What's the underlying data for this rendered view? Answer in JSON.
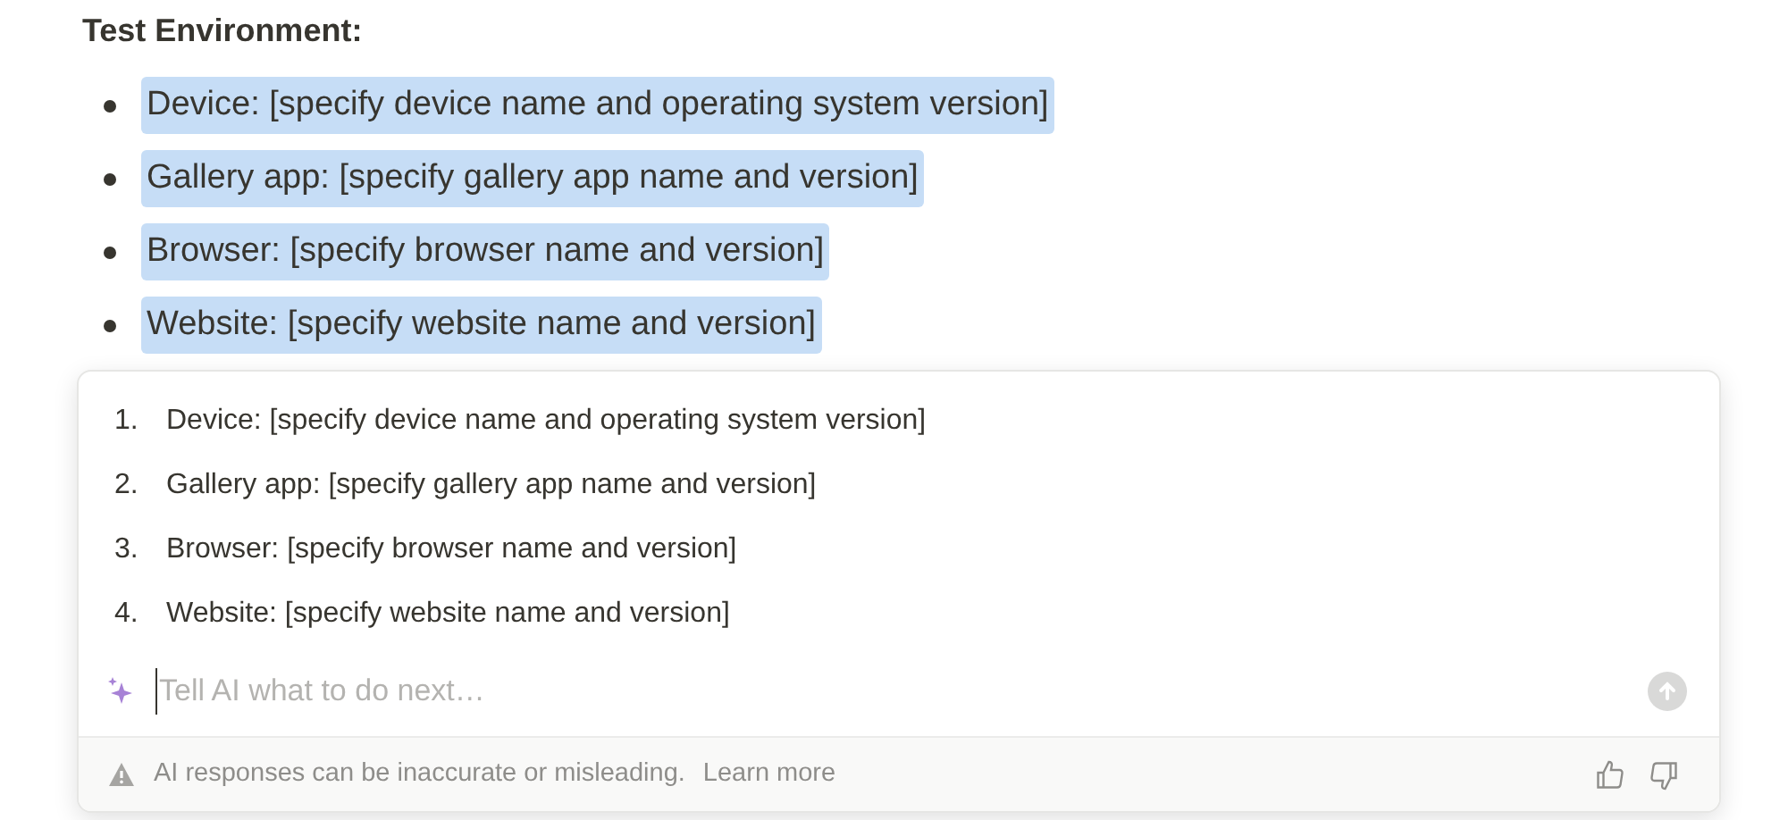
{
  "heading": "Test Environment:",
  "bullets": [
    {
      "text": "Device: [specify device name and operating system version]",
      "selected": true
    },
    {
      "text": "Gallery app: [specify gallery app name and version]",
      "selected": true
    },
    {
      "text": "Browser: [specify browser name and version]",
      "selected": true
    },
    {
      "text": "Website: [specify website name and version]",
      "selected": true
    }
  ],
  "ai_panel": {
    "items": [
      {
        "number": "1.",
        "text": "Device: [specify device name and operating system version]"
      },
      {
        "number": "2.",
        "text": "Gallery app: [specify gallery app name and version]"
      },
      {
        "number": "3.",
        "text": "Browser: [specify browser name and version]"
      },
      {
        "number": "4.",
        "text": "Website: [specify website name and version]"
      }
    ],
    "placeholder": "Tell AI what to do next…",
    "disclaimer": "AI responses can be inaccurate or misleading.",
    "link": "Learn more"
  }
}
